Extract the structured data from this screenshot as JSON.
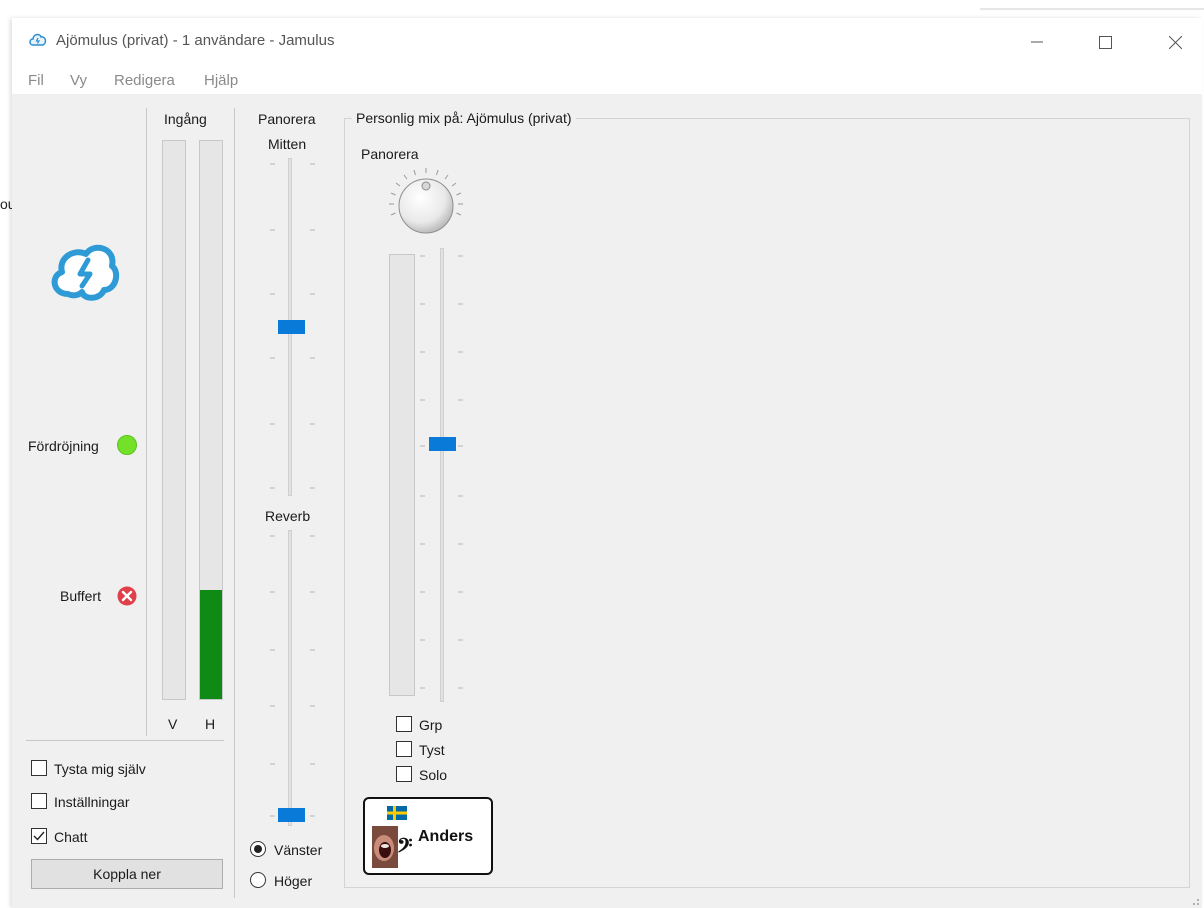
{
  "window": {
    "title": "Ajömulus (privat) - 1 användare - Jamulus",
    "icons": {
      "app": "jamulus-cloud-icon",
      "minimize": "minimize-icon",
      "maximize": "maximize-icon",
      "close": "close-icon"
    }
  },
  "menu": {
    "items": [
      "Fil",
      "Vy",
      "Redigera",
      "Hjälp"
    ]
  },
  "stray_text": "ou",
  "left_panel": {
    "delay_label": "Fördröjning",
    "delay_status_color": "#73e02a",
    "buffer_label": "Buffert",
    "buffer_status_color": "#e0404a",
    "input_title": "Ingång",
    "meter_left_label": "V",
    "meter_right_label": "H",
    "meter_left_level": 0.0,
    "meter_right_level": 0.2,
    "mute_myself_label": "Tysta mig själv",
    "mute_myself_checked": false,
    "settings_label": "Inställningar",
    "settings_checked": false,
    "chat_label": "Chatt",
    "chat_checked": true,
    "disconnect_label": "Koppla ner"
  },
  "middle_panel": {
    "pan_title": "Panorera",
    "pan_value": "Mitten",
    "reverb_label": "Reverb",
    "channel_left_label": "Vänster",
    "channel_right_label": "Höger",
    "selected_channel": "Vänster"
  },
  "mix": {
    "title": "Personlig mix på: Ajömulus (privat)",
    "pan_label": "Panorera",
    "group_label": "Grp",
    "group_checked": false,
    "mute_label": "Tyst",
    "mute_checked": false,
    "solo_label": "Solo",
    "solo_checked": false,
    "musician_name": "Anders",
    "musician_flag": "sweden-flag-icon",
    "musician_instrument": "vocal-bass-icon"
  },
  "colors": {
    "accent": "#0a7ad8",
    "meter_green": "#0f8a14",
    "panel_bg": "#f0f0f0"
  }
}
